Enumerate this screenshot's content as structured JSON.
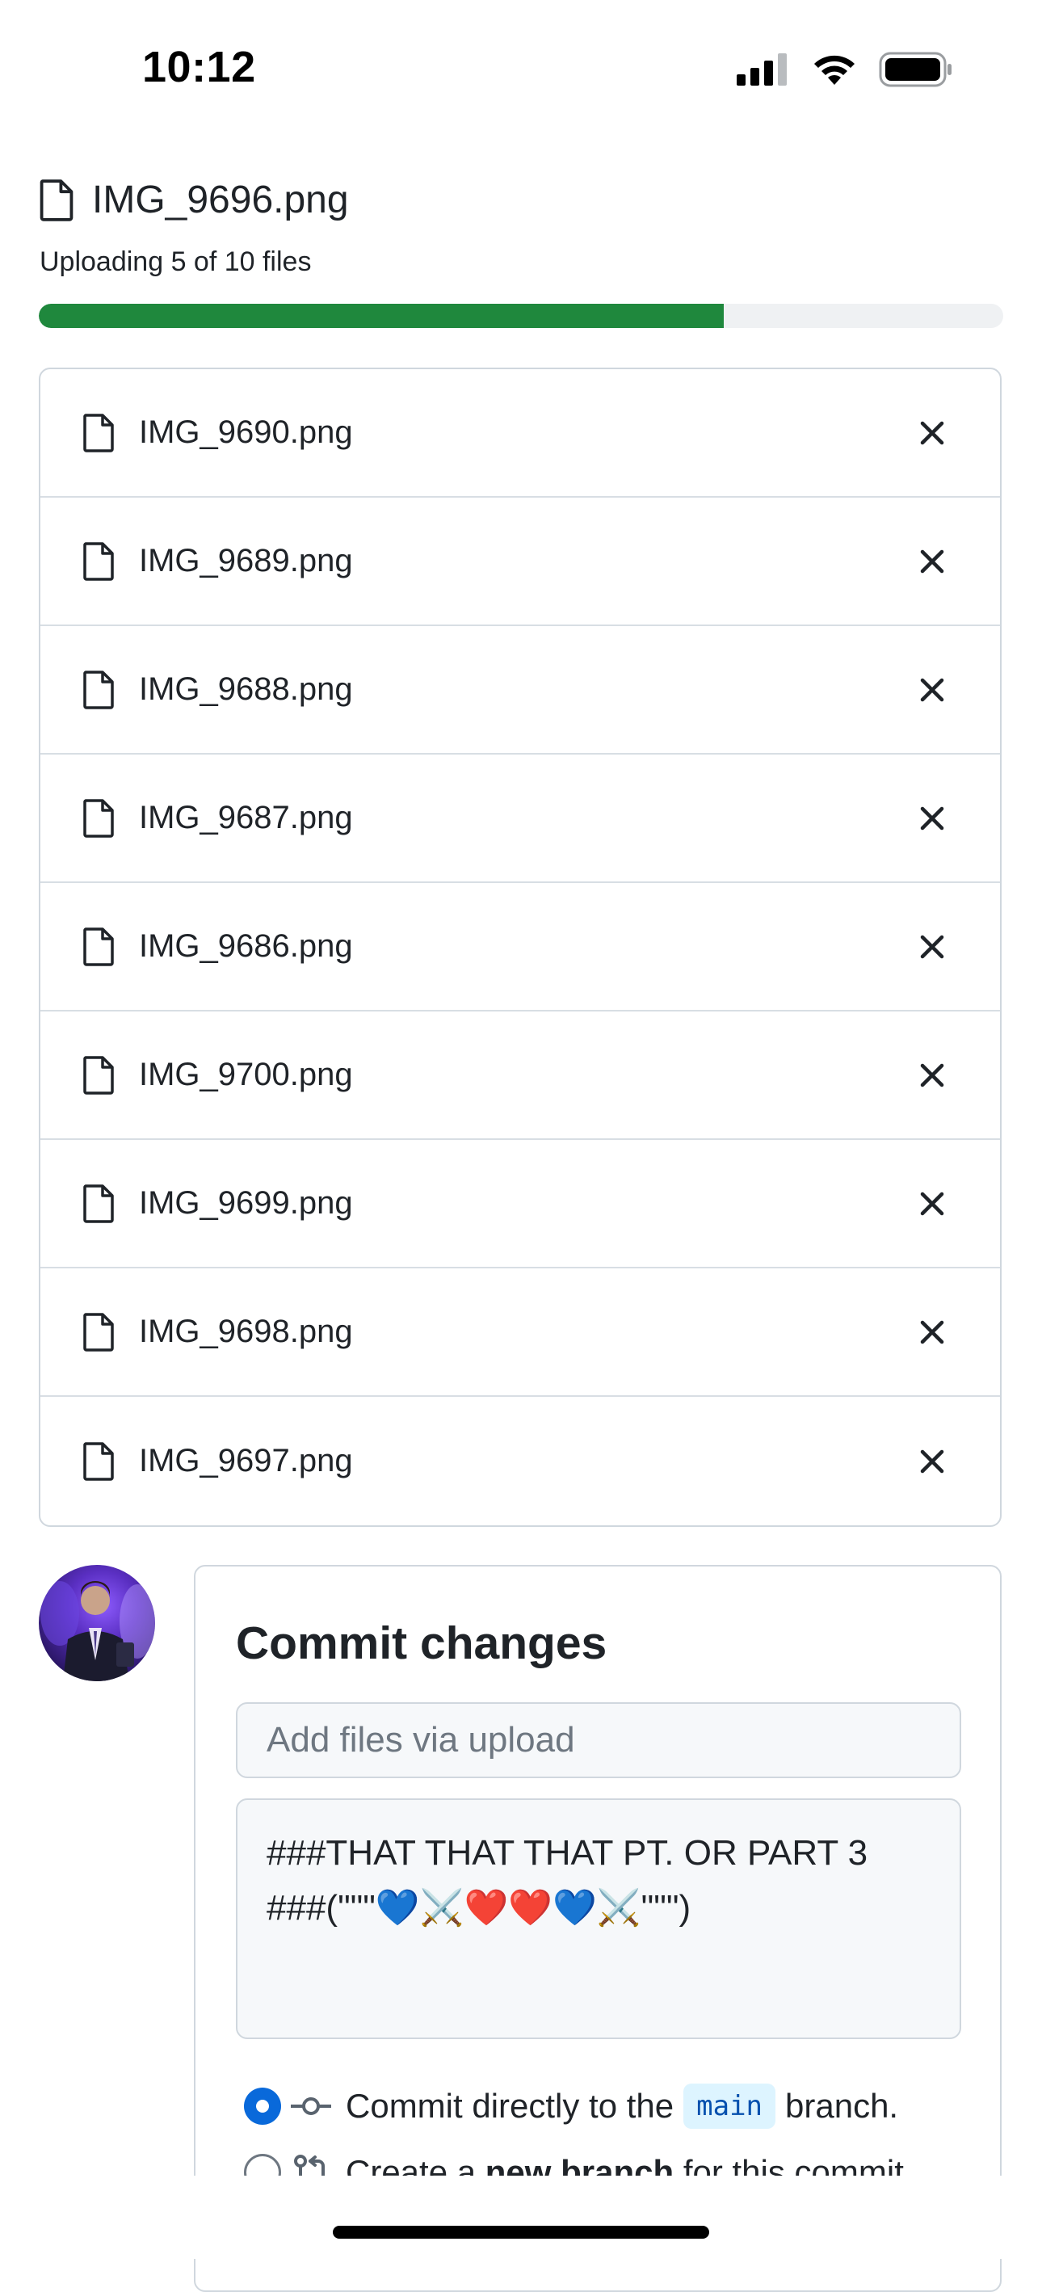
{
  "status_bar": {
    "time": "10:12"
  },
  "upload": {
    "current_file": "IMG_9696.png",
    "status_text": "Uploading 5 of 10 files",
    "progress_fraction": 0.71,
    "progress_color": "#1f883d"
  },
  "files": [
    {
      "name": "IMG_9690.png"
    },
    {
      "name": "IMG_9689.png"
    },
    {
      "name": "IMG_9688.png"
    },
    {
      "name": "IMG_9687.png"
    },
    {
      "name": "IMG_9686.png"
    },
    {
      "name": "IMG_9700.png"
    },
    {
      "name": "IMG_9699.png"
    },
    {
      "name": "IMG_9698.png"
    },
    {
      "name": "IMG_9697.png"
    }
  ],
  "commit": {
    "title": "Commit changes",
    "summary_placeholder": "Add files via upload",
    "summary_value": "",
    "description_value": "###THAT THAT THAT PT. OR PART 3\n###(\"\"\"💙⚔️❤️❤️💙⚔️\"\"\")",
    "option_direct": {
      "prefix": "Commit directly to the",
      "branch": "main",
      "suffix": "branch.",
      "checked": true
    },
    "option_new_branch": {
      "prefix": "Create a",
      "bold": "new branch",
      "suffix": "for this commit",
      "checked": false
    }
  },
  "icons": {
    "file": "file-icon",
    "remove": "close-icon",
    "commit": "git-commit-icon",
    "pull_request": "git-pull-request-icon"
  },
  "colors": {
    "accent_blue": "#0969da",
    "success_green": "#1f883d",
    "border": "#d0d7de"
  }
}
